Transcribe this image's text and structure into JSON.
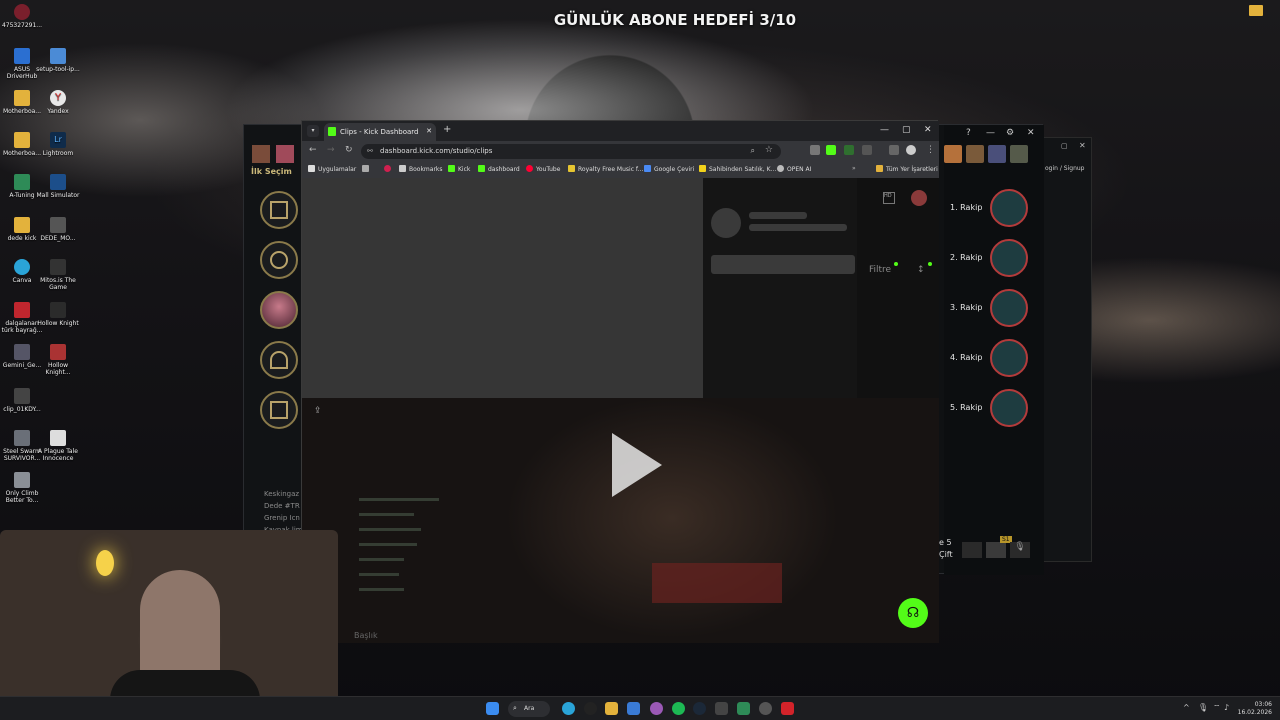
{
  "overlay": {
    "goal_text": "GÜNLÜK ABONE HEDEFİ 3/10"
  },
  "desktop_icons": [
    {
      "label": "475327291..."
    },
    {
      "label": "ASUS DriverHub"
    },
    {
      "label": "setup-tool-ip..."
    },
    {
      "label": "Motherboa..."
    },
    {
      "label": "Yandex"
    },
    {
      "label": "Motherboa..."
    },
    {
      "label": "Lightroom"
    },
    {
      "label": "A-Tuning"
    },
    {
      "label": "Mall Simulator"
    },
    {
      "label": "dede kick"
    },
    {
      "label": "DEDE_MO..."
    },
    {
      "label": "Canva"
    },
    {
      "label": "Mitos.is The Game"
    },
    {
      "label": "dalgalanan türk bayrağ..."
    },
    {
      "label": "Hollow Knight"
    },
    {
      "label": "Gemini_Ge..."
    },
    {
      "label": "Hollow Knight..."
    },
    {
      "label": "clip_01KDY..."
    },
    {
      "label": "Steel Swarm SURVIVOR..."
    },
    {
      "label": "A Plague Tale Innocence"
    },
    {
      "label": "Only Climb Better To..."
    }
  ],
  "game_client": {
    "left_title": "İlk Seçim",
    "rakip": [
      "1. Rakip",
      "2. Rakip",
      "3. Rakip",
      "4. Rakip",
      "5. Rakip"
    ],
    "chat_lines": [
      "Keskingaz",
      "Dede #TR",
      "Grenip Icn",
      "Kaynak lim"
    ],
    "side_text": [
      "e 5",
      "Çift"
    ],
    "badge": "S1",
    "right_link": "ogin / Signup"
  },
  "browser": {
    "tab_title": "Clips - Kick Dashboard",
    "url": "dashboard.kick.com/studio/clips",
    "bookmarks": [
      {
        "label": "Uygulamalar"
      },
      {
        "label": "Bookmarks"
      },
      {
        "label": "Kick"
      },
      {
        "label": "dashboard"
      },
      {
        "label": "YouTube"
      },
      {
        "label": "Royalty Free Music f..."
      },
      {
        "label": "Google Çeviri"
      },
      {
        "label": "Sahibinden Satılık, K..."
      },
      {
        "label": "OPEN AI"
      },
      {
        "label": "Tüm Yer İşaretleri"
      }
    ],
    "filter_label": "Filtre",
    "sort_label": "↕",
    "footer_label": "Başlık",
    "colors": {
      "kick_green": "#53fc18"
    }
  },
  "taskbar": {
    "search_placeholder": "Ara",
    "time": "03:06",
    "date": "16.02.2026"
  }
}
